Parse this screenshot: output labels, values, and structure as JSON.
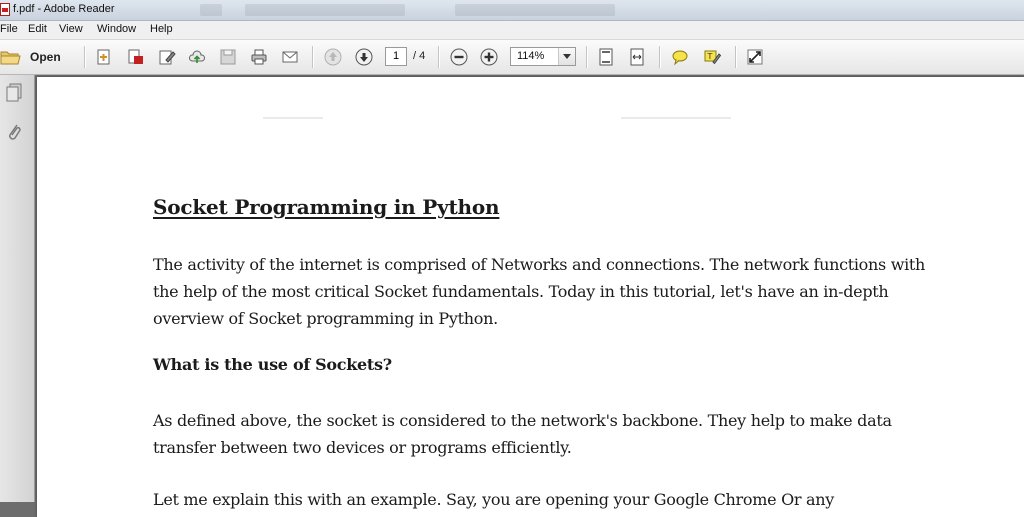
{
  "window": {
    "title": "f.pdf - Adobe Reader"
  },
  "menu": [
    "File",
    "Edit",
    "View",
    "Window",
    "Help"
  ],
  "toolbar": {
    "open_label": "Open",
    "page_current": "1",
    "page_total": "/ 4",
    "zoom_value": "114%"
  },
  "document": {
    "title": "Socket Programming in Python",
    "paragraph1": "The activity of the internet is comprised of Networks and connections. The network functions with the help of the most critical Socket fundamentals. Today in this tutorial, let's have an in-depth overview of Socket programming in Python.",
    "heading2": "What is the use of Sockets?",
    "paragraph2": "As defined above, the socket is considered to the network's backbone. They help to make data transfer between two devices or programs efficiently.",
    "paragraph3": "Let me explain this with an example. Say, you are opening your Google Chrome Or any"
  },
  "colors": {
    "toolbar_bg": "#e6e6e6",
    "doc_bg": "#6d6d6d",
    "page_bg": "#ffffff",
    "pdf_red": "#c42020"
  }
}
